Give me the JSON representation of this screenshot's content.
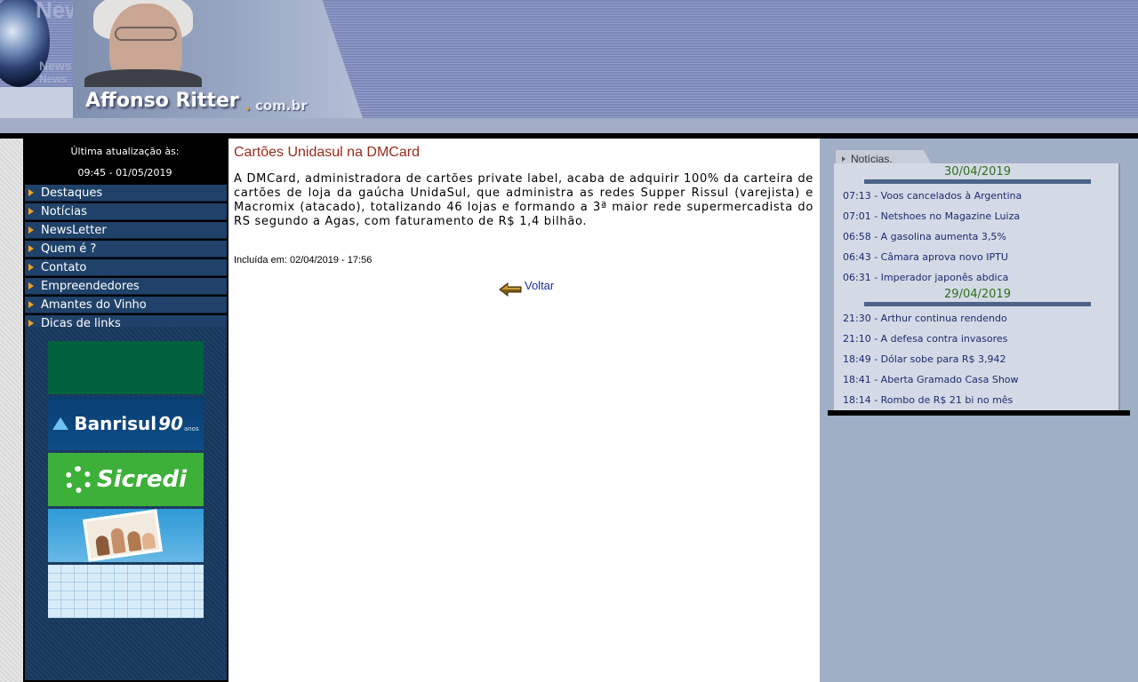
{
  "header": {
    "site_name": "Affonso Ritter",
    "tld_dot": ".",
    "tld": "com.br",
    "news_watermark": [
      "News",
      "News",
      "News"
    ]
  },
  "sidebar": {
    "update_label": "Última atualização às:",
    "update_time": "09:45 - 01/05/2019",
    "menu": [
      {
        "label": "Destaques"
      },
      {
        "label": "Notícias"
      },
      {
        "label": "NewsLetter"
      },
      {
        "label": "Quem é ?"
      },
      {
        "label": "Contato"
      },
      {
        "label": "Empreendedores"
      },
      {
        "label": "Amantes do Vinho"
      },
      {
        "label": "Dicas de links"
      }
    ],
    "banners": {
      "banrisul_name": "Banrisul",
      "banrisul_years": "90",
      "banrisul_anos": "anos",
      "sicredi_name": "Sicredi"
    }
  },
  "article": {
    "title": "Cartões Unidasul na DMCard",
    "body": "A DMCard, administradora de cartões private label, acaba de adquirir 100% da carteira de cartões de loja da gaúcha UnidaSul, que administra as redes Supper Rissul (varejista) e Macromix (atacado), totalizando 46 lojas e formando a 3ª maior rede supermercadista do RS segundo a Agas, com faturamento de R$ 1,4 bilhão.",
    "included": "Incluída em: 02/04/2019 - 17:56",
    "back_label": "Voltar"
  },
  "news": {
    "tab_label": "Notícias.",
    "groups": [
      {
        "date": "30/04/2019",
        "items": [
          "07:13 - Voos cancelados à Argentina",
          "07:01 - Netshoes no Magazine Luiza",
          "06:58 - A gasolina aumenta 3,5%",
          "06:43 - Câmara aprova novo IPTU",
          "06:31 - Imperador japonês abdica"
        ]
      },
      {
        "date": "29/04/2019",
        "items": [
          "21:30 - Arthur continua rendendo",
          "21:10 - A defesa contra invasores",
          "18:49 - Dólar sobe para R$ 3,942",
          "18:41 - Aberta Gramado Casa Show",
          "18:14 - Rombo de R$ 21 bi no mês"
        ]
      }
    ]
  },
  "colors": {
    "menu_bg": "#20426a",
    "menu_arrow": "#f0a21b",
    "title_red": "#9a2c1e",
    "date_green": "#2e6e1c",
    "link_blue": "#1a2fa8"
  }
}
